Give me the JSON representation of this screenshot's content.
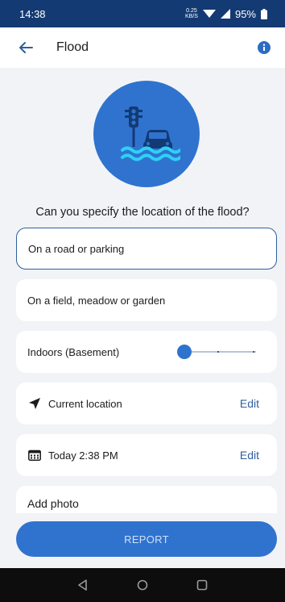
{
  "status_bar": {
    "time": "14:38",
    "net_speed_value": "0.25",
    "net_speed_unit": "KB/S",
    "battery": "95%"
  },
  "header": {
    "title": "Flood"
  },
  "question": "Can you specify the location of the flood?",
  "options": [
    {
      "label": "On a road or parking",
      "selected": true
    },
    {
      "label": "On a field, meadow or garden",
      "selected": false
    },
    {
      "label": "Indoors (Basement)",
      "selected": false
    }
  ],
  "location": {
    "label": "Current location",
    "edit_label": "Edit"
  },
  "datetime": {
    "label": "Today 2:38 PM",
    "edit_label": "Edit"
  },
  "photo": {
    "label": "Add photo"
  },
  "report_button": "REPORT",
  "colors": {
    "primary": "#2f73cf",
    "status_bar": "#143a73",
    "link": "#2f5f9e",
    "wave": "#2fd0f5"
  },
  "icons": [
    "back-arrow-icon",
    "info-icon",
    "traffic-light-icon",
    "car-icon",
    "water-wave-icon",
    "navigation-arrow-icon",
    "calendar-icon"
  ]
}
